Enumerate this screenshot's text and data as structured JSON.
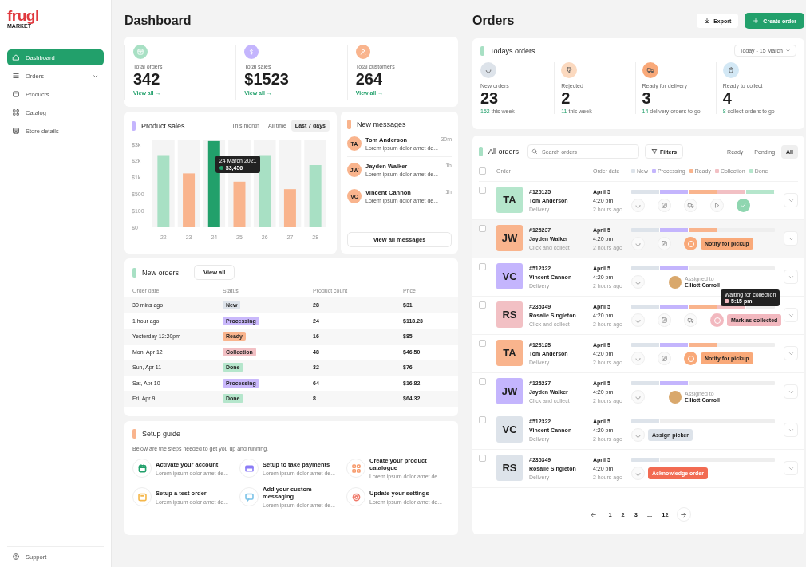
{
  "sidebar": {
    "logo": {
      "name": "frugl",
      "tagline": "MARKET"
    },
    "items": [
      {
        "kind": "home",
        "label": "Dashboard",
        "selected": true
      },
      {
        "kind": "list",
        "label": "Orders",
        "selected": false,
        "expanded": false
      },
      {
        "kind": "box",
        "label": "Products",
        "selected": false
      },
      {
        "kind": "grid",
        "label": "Catalog",
        "selected": false
      },
      {
        "kind": "store",
        "label": "Store details",
        "selected": false
      }
    ],
    "support": {
      "label": "Support"
    }
  },
  "dashboard": {
    "title": "Dashboard",
    "stats": [
      {
        "kind": "orders",
        "color": "#a8e0c4",
        "label": "Total orders",
        "value": "342",
        "link": "View all →"
      },
      {
        "kind": "dollar",
        "color": "#c4b5fd",
        "label": "Total sales",
        "value": "$1523",
        "link": "View all →"
      },
      {
        "kind": "user",
        "color": "#f9b48d",
        "label": "Total customers",
        "value": "264",
        "link": "View all →"
      }
    ],
    "product_sales": {
      "title": "Product sales",
      "ranges": [
        {
          "label": "This month",
          "selected": false
        },
        {
          "label": "All time",
          "selected": false
        },
        {
          "label": "Last 7 days",
          "selected": true
        }
      ],
      "chart": {
        "x_labels": [
          "22",
          "23",
          "24",
          "25",
          "26",
          "27",
          "28"
        ],
        "y_labels": [
          "$3k",
          "$2k",
          "$1k",
          "$500",
          "$100",
          "$0"
        ],
        "tooltip": {
          "date": "24 March 2021",
          "value": "$3,456"
        }
      }
    },
    "messages": {
      "title": "New messages",
      "items": [
        {
          "initials": "TA",
          "name": "Tom Anderson",
          "text": "Lorem ipsum dolor amet de...",
          "time": "30m"
        },
        {
          "initials": "JW",
          "name": "Jayden Walker",
          "text": "Lorem ipsum dolor amet de...",
          "time": "1h"
        },
        {
          "initials": "VC",
          "name": "Vincent Cannon",
          "text": "Lorem ipsum dolor amet de...",
          "time": "1h"
        }
      ],
      "button": "View all messages"
    },
    "new_orders": {
      "title": "New orders",
      "button": "View all",
      "columns": [
        "Order date",
        "Status",
        "Product count",
        "Price"
      ],
      "rows": [
        {
          "date": "30 mins ago",
          "status": "New",
          "color": "#dde3ea",
          "count": "28",
          "price": "$31"
        },
        {
          "date": "1 hour ago",
          "status": "Processing",
          "color": "#c9b8fb",
          "count": "24",
          "price": "$118.23"
        },
        {
          "date": "Yesterday 12:20pm",
          "status": "Ready",
          "color": "#f9b48d",
          "count": "16",
          "price": "$85"
        },
        {
          "date": "Mon, Apr 12",
          "status": "Collection",
          "color": "#f2c0c4",
          "count": "48",
          "price": "$46.50"
        },
        {
          "date": "Sun, Apr 11",
          "status": "Done",
          "color": "#b5e6cc",
          "count": "32",
          "price": "$76"
        },
        {
          "date": "Sat, Apr 10",
          "status": "Processing",
          "color": "#c9b8fb",
          "count": "64",
          "price": "$16.82"
        },
        {
          "date": "Fri, Apr 9",
          "status": "Done",
          "color": "#b5e6cc",
          "count": "8",
          "price": "$64.32"
        }
      ]
    },
    "setup_guide": {
      "title": "Setup guide",
      "description": "Below are the steps needed to get you up and running.",
      "steps": [
        {
          "kind": "calendar",
          "color": "#22a06b",
          "title": "Activate your account",
          "text": "Lorem ipsum dolor amet de..."
        },
        {
          "kind": "card",
          "color": "#8b7cf6",
          "title": "Setup to take payments",
          "text": "Lorem ipsum dolor amet de..."
        },
        {
          "kind": "grid",
          "color": "#f79a6b",
          "title": "Create your product catalogue",
          "text": "Lorem ipsum dolor amet de..."
        },
        {
          "kind": "box",
          "color": "#f5b74a",
          "title": "Setup a test order",
          "text": "Lorem ipsum dolor amet de..."
        },
        {
          "kind": "message",
          "color": "#7cc3e8",
          "title": "Add your custom messaging",
          "text": "Lorem ipsum dolor amet de..."
        },
        {
          "kind": "gear",
          "color": "#f07a6a",
          "title": "Update your settings",
          "text": "Lorem ipsum dolor amet de..."
        }
      ]
    }
  },
  "orders": {
    "title": "Orders",
    "export": "Export",
    "create": "Create order",
    "todays": {
      "title": "Todays orders",
      "date_filter": "Today - 15 March",
      "stats": [
        {
          "kind": "refresh",
          "color": "#dde3ea",
          "label": "New orders",
          "value": "23",
          "note_count": "152",
          "note_text": "this week"
        },
        {
          "kind": "thumbs-down",
          "color": "#fbd9bf",
          "label": "Rejected",
          "value": "2",
          "note_count": "11",
          "note_text": "this week"
        },
        {
          "kind": "truck",
          "color": "#f9a979",
          "label": "Ready for delivery",
          "value": "3",
          "note_count": "14",
          "note_text": "delivery orders to go"
        },
        {
          "kind": "bag",
          "color": "#d3e8f5",
          "label": "Ready to collect",
          "value": "4",
          "note_count": "8",
          "note_text": "collect orders to go"
        }
      ]
    },
    "all": {
      "title": "All orders",
      "search_placeholder": "Search orders",
      "filters": "Filters",
      "tabs": [
        {
          "label": "Ready",
          "selected": false
        },
        {
          "label": "Pending",
          "selected": false
        },
        {
          "label": "All",
          "selected": true
        }
      ],
      "columns": {
        "all_checked": false,
        "order": "Order",
        "date": "Order date"
      },
      "legend": [
        {
          "label": "New",
          "color": "#dde3ea"
        },
        {
          "label": "Processing",
          "color": "#c4b5fd"
        },
        {
          "label": "Ready",
          "color": "#f9b48d"
        },
        {
          "label": "Collection",
          "color": "#f2c0c4"
        },
        {
          "label": "Done",
          "color": "#b5e6cc"
        }
      ],
      "rows": [
        {
          "selected": false,
          "checked": false,
          "initials": "TA",
          "color": "#b5e6cc",
          "id": "#125125",
          "name": "Tom Anderson",
          "method": "Delivery",
          "date": "April 5",
          "time": "4:20 pm",
          "ago": "2 hours ago",
          "level": 1,
          "steps": [
            {
              "kind": "refresh"
            },
            {
              "kind": "edit"
            },
            {
              "kind": "truck"
            },
            {
              "kind": "play"
            },
            {
              "kind": "done",
              "color": "#8fd6b0"
            }
          ]
        },
        {
          "selected": true,
          "checked": false,
          "initials": "JW",
          "color": "#f9b48d",
          "id": "#125237",
          "name": "Jayden Walker",
          "method": "Click and collect",
          "date": "April 5",
          "time": "4:20 pm",
          "ago": "2 hours ago",
          "level": 0.6,
          "steps": [
            {
              "kind": "refresh"
            },
            {
              "kind": "edit"
            },
            {
              "kind": "active",
              "color": "#f9a979"
            }
          ],
          "action": {
            "label": "Notify for pickup",
            "color": "#f9a979"
          }
        },
        {
          "selected": false,
          "checked": false,
          "initials": "VC",
          "color": "#c4b5fd",
          "id": "#512322",
          "name": "Vincent Cannon",
          "method": "Delivery",
          "date": "April 5",
          "time": "4:20 pm",
          "ago": "2 hours ago",
          "level": 0.4,
          "steps": [
            {
              "kind": "refresh"
            }
          ],
          "assignee": {
            "caption": "Assigned to",
            "name": "Elliott Carroll"
          }
        },
        {
          "selected": false,
          "checked": false,
          "initials": "RS",
          "color": "#f2c0c4",
          "id": "#235349",
          "name": "Rosalie Singleton",
          "method": "Click and collect",
          "date": "April 5",
          "time": "4:20 pm",
          "ago": "2 hours ago",
          "level": 0.8,
          "steps": [
            {
              "kind": "refresh"
            },
            {
              "kind": "edit"
            },
            {
              "kind": "truck"
            },
            {
              "kind": "active",
              "color": "#f2b8bf"
            }
          ],
          "action": {
            "label": "Mark as collected",
            "color": "#f2b8bf"
          },
          "tooltip": {
            "title": "Waiting for collection",
            "time": "5:15 pm",
            "color": "#f2b8bf"
          }
        },
        {
          "selected": false,
          "checked": false,
          "initials": "TA",
          "color": "#f9b48d",
          "id": "#125125",
          "name": "Tom Anderson",
          "method": "Delivery",
          "date": "April 5",
          "time": "4:20 pm",
          "ago": "2 hours ago",
          "level": 0.6,
          "steps": [
            {
              "kind": "refresh"
            },
            {
              "kind": "edit"
            },
            {
              "kind": "active",
              "color": "#f9a979"
            }
          ],
          "action": {
            "label": "Notify for pickup",
            "color": "#f9a979"
          }
        },
        {
          "selected": false,
          "checked": false,
          "initials": "JW",
          "color": "#c4b5fd",
          "id": "#125237",
          "name": "Jayden Walker",
          "method": "Click and collect",
          "date": "April 5",
          "time": "4:20 pm",
          "ago": "2 hours ago",
          "level": 0.4,
          "steps": [
            {
              "kind": "refresh"
            }
          ],
          "assignee": {
            "caption": "Assigned to",
            "name": "Elliott Carroll"
          }
        },
        {
          "selected": false,
          "checked": false,
          "initials": "VC",
          "color": "#dde3ea",
          "id": "#512322",
          "name": "Vincent Cannon",
          "method": "Delivery",
          "date": "April 5",
          "time": "4:20 pm",
          "ago": "2 hours ago",
          "level": 0.2,
          "steps": [
            {
              "kind": "refresh"
            }
          ],
          "action": {
            "label": "Assign picker",
            "color": "#dde3ea"
          }
        },
        {
          "selected": false,
          "checked": false,
          "initials": "RS",
          "color": "#dde3ea",
          "id": "#235349",
          "name": "Rosalie Singleton",
          "method": "Delivery",
          "date": "April 5",
          "time": "4:20 pm",
          "ago": "2 hours ago",
          "level": 0.2,
          "steps": [
            {
              "kind": "refresh"
            }
          ],
          "action": {
            "label": "Acknowledge order",
            "color": "#f26b52"
          }
        }
      ],
      "pagination": {
        "pages": [
          "1",
          "2",
          "3",
          "...",
          "12"
        ]
      }
    }
  }
}
